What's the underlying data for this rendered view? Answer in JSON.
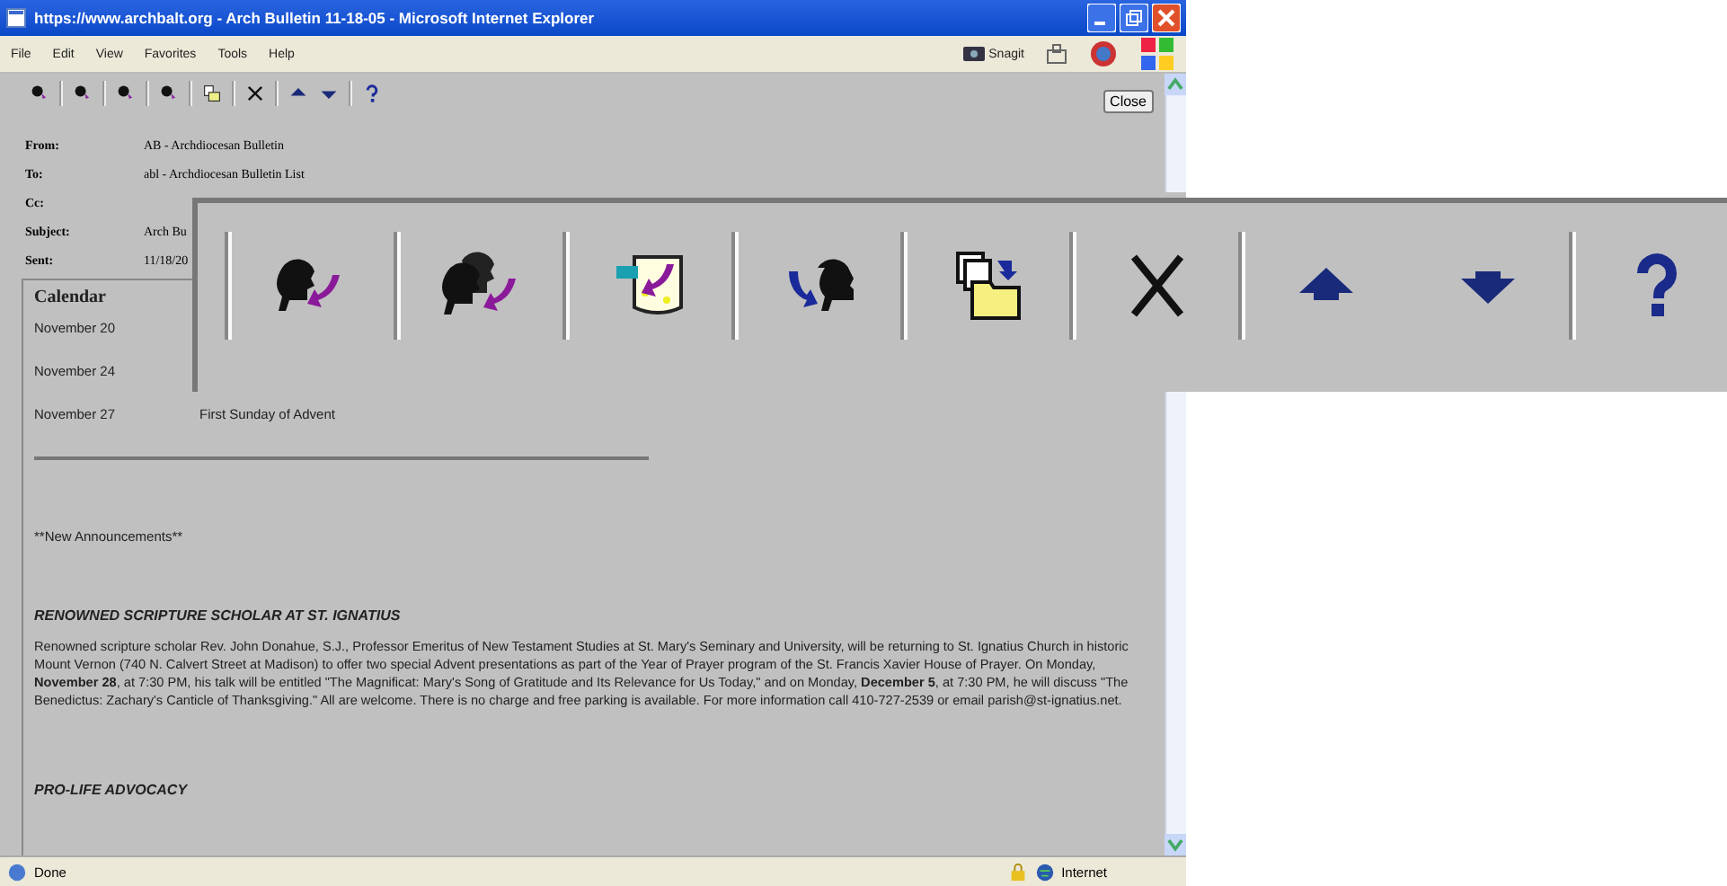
{
  "window": {
    "title": "https://www.archbalt.org - Arch Bulletin 11-18-05 - Microsoft Internet Explorer"
  },
  "menu": [
    "File",
    "Edit",
    "View",
    "Favorites",
    "Tools",
    "Help"
  ],
  "snagit": "Snagit",
  "close_button": "Close",
  "header_fields": [
    {
      "label": "From:",
      "value": "AB - Archdiocesan Bulletin"
    },
    {
      "label": "To:",
      "value": "abl - Archdiocesan Bulletin List"
    },
    {
      "label": "Cc:"
    },
    {
      "label": "Subject:",
      "value": "Arch Bu"
    },
    {
      "label": "Sent:",
      "value": "11/18/20"
    }
  ],
  "calendar": {
    "title": "Calendar",
    "rows": [
      {
        "date": "November 20"
      },
      {
        "date": "November 24"
      },
      {
        "date": "November 27",
        "event": "First Sunday of Advent"
      }
    ]
  },
  "announcements_label": "**New Announcements**",
  "sections": [
    {
      "heading": "RENOWNED SCRIPTURE SCHOLAR AT ST. IGNATIUS",
      "body": "Renowned scripture scholar Rev. John Donahue, S.J., Professor Emeritus of New Testament Studies at St. Mary's Seminary and University, will be returning to St. Ignatius Church in historic Mount Vernon (740 N. Calvert Street at Madison) to offer two special Advent presentations as part of the Year of Prayer program of the St. Francis Xavier House of Prayer. On Monday, **November 28**, at 7:30 PM, his talk will be entitled \"The Magnificat: Mary's Song of Gratitude and Its Relevance for Us Today,\" and on Monday, **December 5**, at 7:30 PM, he will discuss \"The Benedictus: Zachary's Canticle of Thanksgiving.\" All are welcome. There is no charge and free parking is available. For more information call 410-727-2539 or email parish@st-ignatius.net."
    },
    {
      "heading": "PRO-LIFE ADVOCACY"
    }
  ],
  "status_bar": {
    "text": "Done",
    "zone": "Internet"
  }
}
